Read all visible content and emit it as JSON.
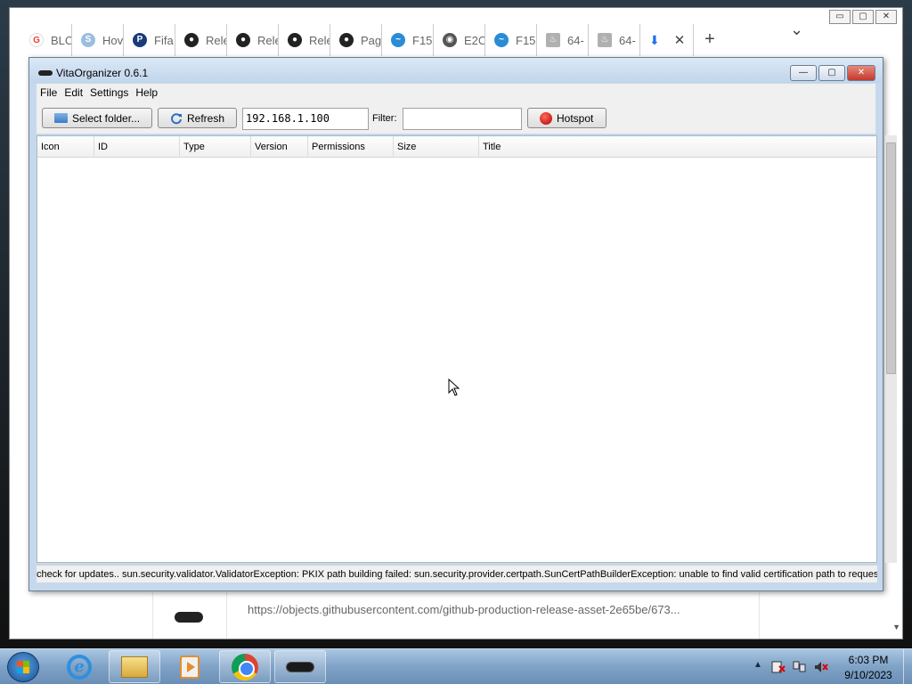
{
  "browser": {
    "tabs": [
      {
        "label": "BLC",
        "icon": "google-icon",
        "color": "#ea4335",
        "glyph": "G"
      },
      {
        "label": "Hov",
        "icon": "s-icon",
        "color": "#7aa7d6",
        "glyph": "S"
      },
      {
        "label": "Fifa",
        "icon": "playstation-icon",
        "color": "#1b3a7a",
        "glyph": "P"
      },
      {
        "label": "Rele",
        "icon": "github-icon",
        "color": "#222222",
        "glyph": "●"
      },
      {
        "label": "Rele",
        "icon": "github-icon",
        "color": "#222222",
        "glyph": "●"
      },
      {
        "label": "Rele",
        "icon": "github-icon",
        "color": "#222222",
        "glyph": "●"
      },
      {
        "label": "Pag",
        "icon": "github-icon",
        "color": "#222222",
        "glyph": "●"
      },
      {
        "label": "F15",
        "icon": "cloud-icon",
        "color": "#2b8bd6",
        "glyph": "~"
      },
      {
        "label": "E2C",
        "icon": "globe-icon",
        "color": "#555555",
        "glyph": "◉"
      },
      {
        "label": "F15",
        "icon": "cloud-icon",
        "color": "#2b8bd6",
        "glyph": "~"
      },
      {
        "label": "64-",
        "icon": "java-icon",
        "color": "#b0b0b0",
        "glyph": "♨"
      },
      {
        "label": "64-",
        "icon": "java-icon",
        "color": "#b0b0b0",
        "glyph": "♨"
      }
    ],
    "active_tab": {
      "icon": "download-icon",
      "glyph": "⬇",
      "close": "✕"
    },
    "new_tab": "+",
    "tab_list": "⌄",
    "window_controls": {
      "minimize": "▭",
      "maximize": "▢",
      "close": "✕"
    },
    "download": {
      "url": "https://objects.githubusercontent.com/github-production-release-asset-2e65be/673..."
    },
    "scroll_down": "▼"
  },
  "app": {
    "title": "VitaOrganizer 0.6.1",
    "window_controls": {
      "minimize": "—",
      "maximize": "▢",
      "close": "✕"
    },
    "menu": [
      "File",
      "Edit",
      "Settings",
      "Help"
    ],
    "toolbar": {
      "select_folder": "Select folder...",
      "refresh": "Refresh",
      "ip_value": "192.168.1.100",
      "filter_label": "Filter:",
      "filter_value": "",
      "hotspot": "Hotspot"
    },
    "columns": [
      "Icon",
      "ID",
      "Type",
      "Version",
      "Permissions",
      "Size",
      "Title"
    ],
    "status": "check for updates.. sun.security.validator.ValidatorException: PKIX path building failed: sun.security.provider.certpath.SunCertPathBuilderException: unable to find valid certification path to requested target"
  },
  "taskbar": {
    "items": [
      "start-button",
      "internet-explorer-icon",
      "explorer-icon",
      "media-player-icon",
      "chrome-icon",
      "vitaorganizer-icon"
    ],
    "tray": {
      "arrow": "▲",
      "time": "6:03 PM",
      "date": "9/10/2023"
    }
  }
}
